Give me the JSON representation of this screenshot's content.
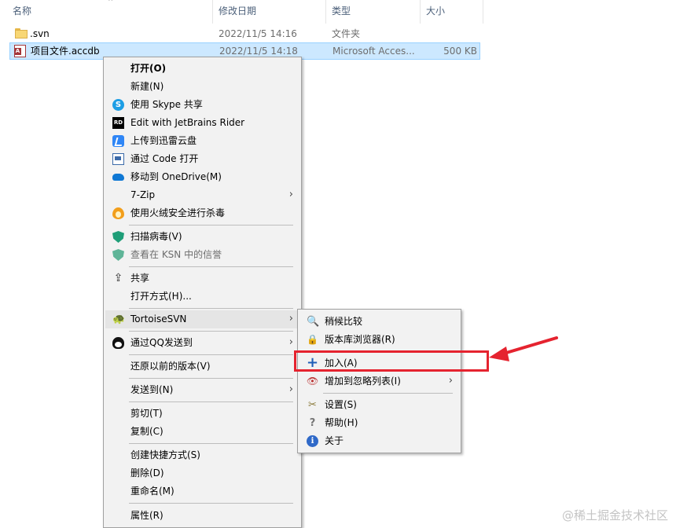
{
  "columns": {
    "name": "名称",
    "date": "修改日期",
    "type": "类型",
    "size": "大小"
  },
  "files": [
    {
      "name": ".svn",
      "date": "2022/11/5 14:16",
      "type": "文件夹",
      "size": "",
      "icon": "folder-icon",
      "selected": false
    },
    {
      "name": "项目文件.accdb",
      "date": "2022/11/5 14:18",
      "type": "Microsoft Acces...",
      "size": "500 KB",
      "icon": "access-file-icon",
      "selected": true
    }
  ],
  "context_menu": {
    "open": "打开(O)",
    "new": "新建(N)",
    "skype": "使用 Skype 共享",
    "rider": "Edit with JetBrains Rider",
    "xunlei": "上传到迅雷云盘",
    "code": "通过 Code 打开",
    "onedrive": "移动到 OneDrive(M)",
    "zip": "7-Zip",
    "huorong": "使用火绒安全进行杀毒",
    "scan": "扫描病毒(V)",
    "ksn": "查看在 KSN 中的信誉",
    "share": "共享",
    "open_with": "打开方式(H)...",
    "tortoise": "TortoiseSVN",
    "qq": "通过QQ发送到",
    "restore": "还原以前的版本(V)",
    "send_to": "发送到(N)",
    "cut": "剪切(T)",
    "copy": "复制(C)",
    "shortcut": "创建快捷方式(S)",
    "delete": "删除(D)",
    "rename": "重命名(M)",
    "properties": "属性(R)"
  },
  "svn_menu": {
    "diff": "稍候比较",
    "repo_browser": "版本库浏览器(R)",
    "add": "加入(A)",
    "ignore": "增加到忽略列表(I)",
    "settings": "设置(S)",
    "help": "帮助(H)",
    "about": "关于"
  },
  "annotation": {
    "color": "#e5232f"
  },
  "watermark": "@稀土掘金技术社区",
  "colors": {
    "selection": "#cce8ff",
    "menu_bg": "#f2f2f2",
    "header_text": "#4c607a"
  }
}
